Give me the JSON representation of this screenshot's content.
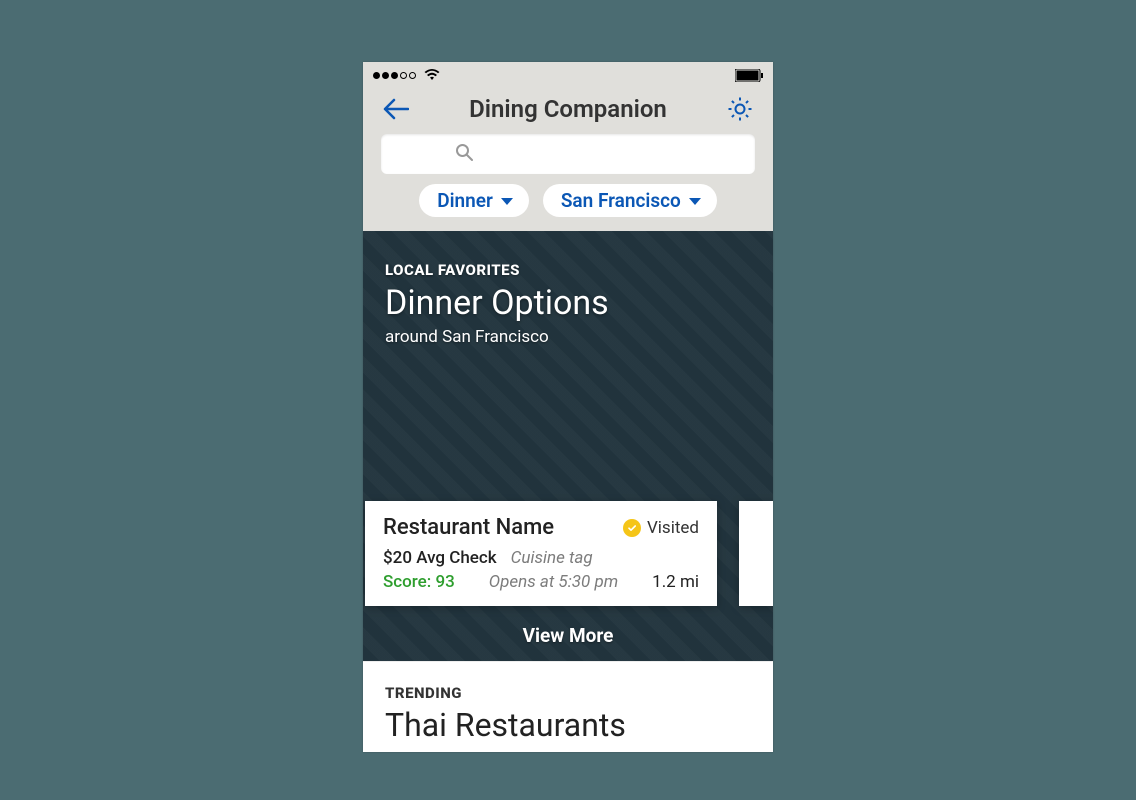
{
  "header": {
    "title": "Dining Companion"
  },
  "search": {
    "placeholder": ""
  },
  "filters": {
    "meal": "Dinner",
    "location": "San Francisco"
  },
  "hero": {
    "eyebrow": "LOCAL FAVORITES",
    "title": "Dinner Options",
    "subtitle": "around San Francisco",
    "view_more": "View More"
  },
  "card": {
    "name": "Restaurant Name",
    "visited_label": "Visited",
    "avg_check": "$20 Avg Check",
    "cuisine_tag": "Cuisine tag",
    "score": "Score: 93",
    "opens": "Opens at 5:30 pm",
    "distance": "1.2 mi"
  },
  "trending": {
    "eyebrow": "TRENDING",
    "title": "Thai Restaurants"
  },
  "colors": {
    "accent_blue": "#0b57b5",
    "score_green": "#2e9e2e",
    "visited_yellow": "#f5c518"
  }
}
